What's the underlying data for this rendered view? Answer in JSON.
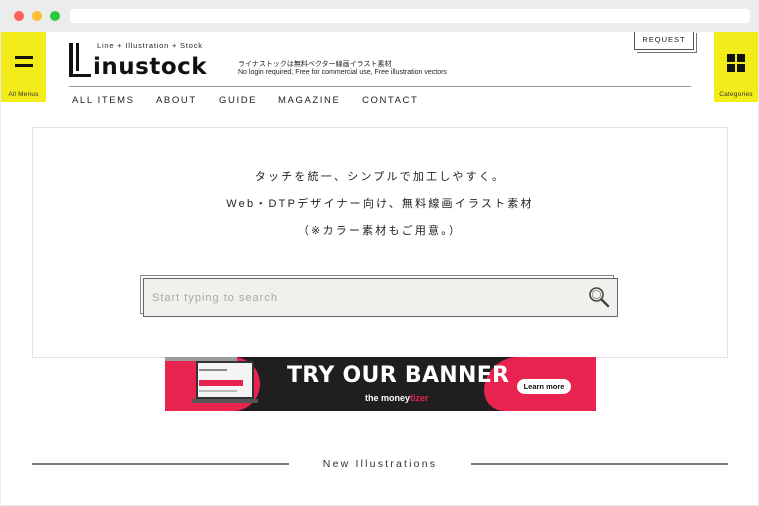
{
  "header": {
    "all_menus_label": "All Menus",
    "categories_label": "Categories",
    "logo_tagline": "Line + Illustration + Stock",
    "logo_word": "inustock",
    "tagline_jp": "ライナストックは無料ベクター線画イラスト素材",
    "tagline_en": "No login required, Free for commercial use, Free illustration vectors",
    "request_label": "REQUEST"
  },
  "nav": {
    "items": [
      {
        "label": "ALL ITEMS"
      },
      {
        "label": "ABOUT"
      },
      {
        "label": "GUIDE"
      },
      {
        "label": "MAGAZINE"
      },
      {
        "label": "CONTACT"
      }
    ]
  },
  "hero": {
    "line1": "タッチを統一、シンプルで加工しやすく。",
    "line2": "Web・DTPデザイナー向け、無料線画イラスト素材",
    "line3": "（※カラー素材もご用意。）",
    "search_placeholder": "Start typing to search"
  },
  "banner": {
    "title": "TRY OUR BANNER",
    "brand_prefix": "the",
    "brand_main": "money",
    "brand_suffix": "tizer",
    "cta": "Learn more"
  },
  "section": {
    "title": "New Illustrations"
  },
  "colors": {
    "accent_yellow": "#f3ec1a",
    "banner_pink": "#e8234f",
    "banner_dark": "#201e1f"
  }
}
